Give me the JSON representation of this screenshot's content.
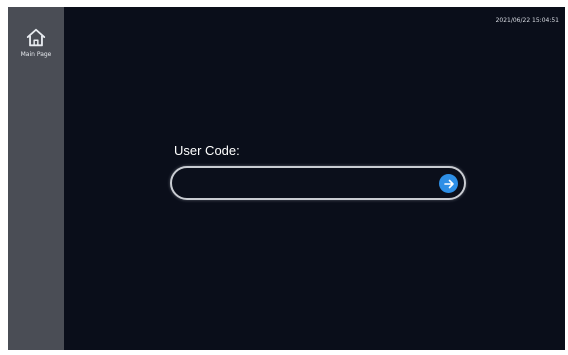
{
  "sidebar": {
    "home": {
      "icon": "home-icon",
      "label": "Main Page"
    }
  },
  "header": {
    "datetime": "2021/06/22 15:04:51"
  },
  "login": {
    "label": "User Code:",
    "input_value": "",
    "submit_icon": "arrow-right-icon"
  },
  "colors": {
    "background": "#0a0e1a",
    "sidebar": "#4a4d55",
    "accent": "#2e8fe6"
  }
}
